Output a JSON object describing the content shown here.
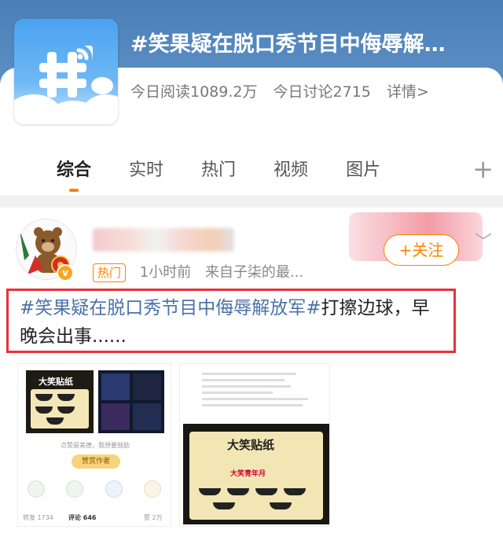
{
  "topic": {
    "title": "#笑果疑在脱口秀节目中侮辱解…",
    "reads": "今日阅读1089.2万",
    "discussions": "今日讨论2715",
    "details": "详情>"
  },
  "tabs": [
    "综合",
    "实时",
    "热门",
    "视频",
    "图片"
  ],
  "post": {
    "badge": "热门",
    "time": "1小时前",
    "source": "来自子柒的最...",
    "follow_label": "+关注",
    "verify_mark": "v",
    "text_hashtag": "#笑果疑在脱口秀节目中侮辱解放军#",
    "text_body": "打擦边球，早晚会出事......"
  },
  "thumb1": {
    "sticker_title": "大笑贴纸",
    "reward_label": "赞赏作者",
    "forward": "转发 1734",
    "comments": "评论 646",
    "likes": "赞 2万",
    "caption": "点赞是美德，我想要鼓励"
  },
  "thumb2": {
    "sticker_title": "大笑贴纸",
    "sticker_sub": "大笑青年月"
  },
  "colors": {
    "accent": "#ff8200",
    "hashtag": "#4a72a8",
    "highlight_border": "#e8313b"
  }
}
